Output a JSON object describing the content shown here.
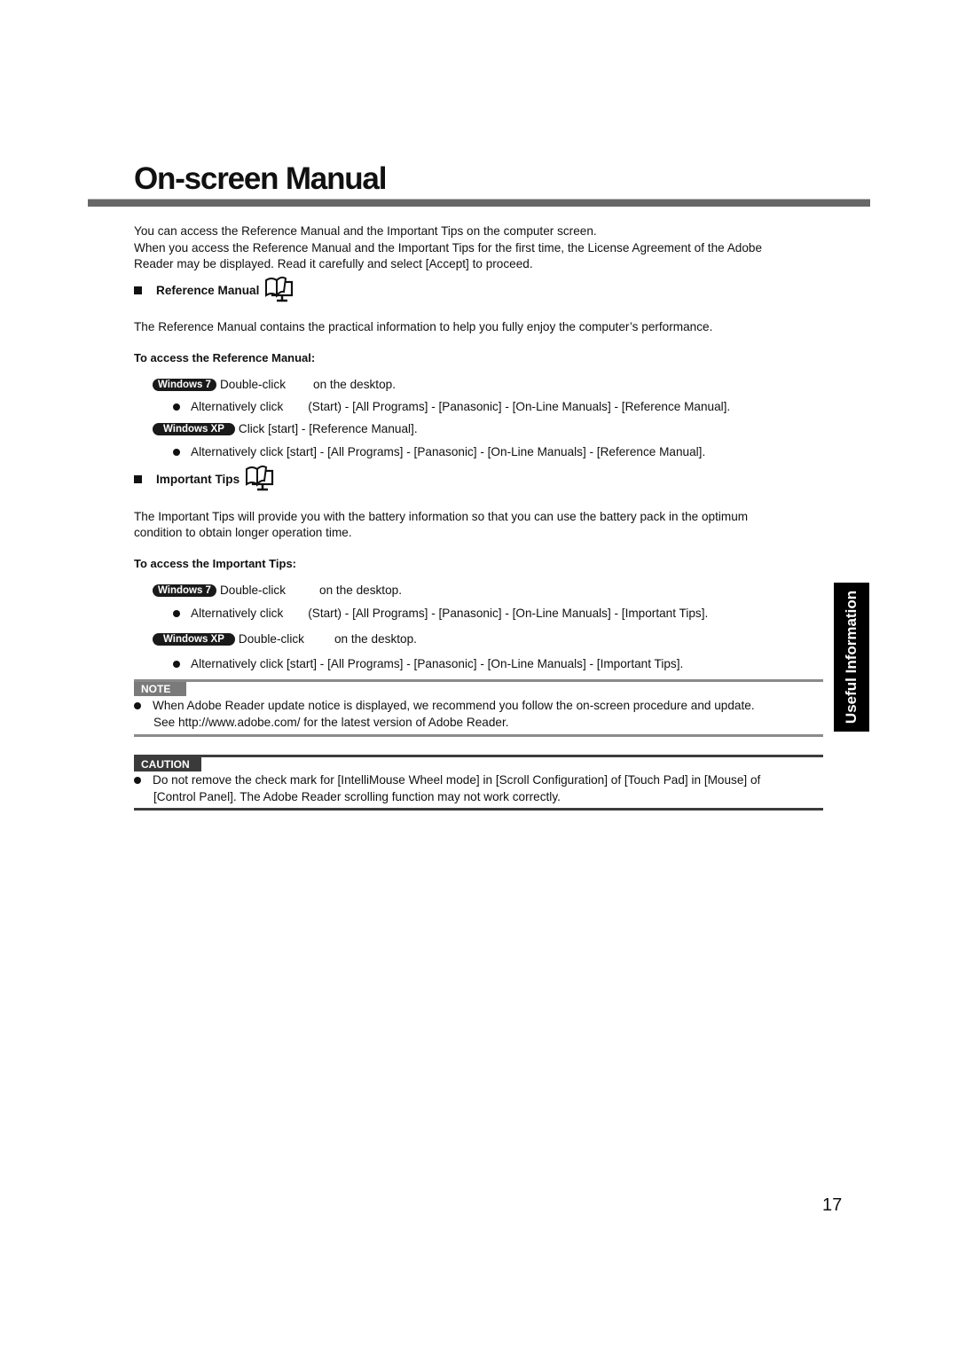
{
  "page": {
    "title": "On-screen Manual",
    "intro": [
      "You can access the Reference Manual and the Important Tips on the computer screen.",
      "When you access the Reference Manual and the Important Tips for the first time, the License Agreement of the Adobe",
      "Reader may be displayed. Read it carefully and select [Accept] to proceed."
    ],
    "side_tab": "Useful Information",
    "page_number": "17"
  },
  "reference_manual": {
    "heading": "Reference Manual",
    "icon": "manual-screen-icon",
    "description": "The Reference Manual contains the practical information to help you fully enjoy the computer’s performance.",
    "access_heading": "To access the Reference Manual:",
    "win7": {
      "badge": "Windows 7",
      "action": "Double-click",
      "action_suffix": "on the desktop.",
      "alt_prefix": "Alternatively click",
      "alt_path": "(Start) - [All Programs] - [Panasonic] - [On-Line Manuals] - [Reference Manual]."
    },
    "winxp": {
      "badge": "Windows XP",
      "action": "Click [start] - [Reference Manual].",
      "alt": "Alternatively click [start] - [All Programs] - [Panasonic] - [On-Line Manuals] - [Reference Manual]."
    }
  },
  "important_tips": {
    "heading": "Important Tips",
    "icon": "manual-screen-icon",
    "description": [
      "The Important Tips will provide you with the battery information so that you can use the battery pack in the optimum",
      "condition to obtain longer operation time."
    ],
    "access_heading": "To access the Important Tips:",
    "win7": {
      "badge": "Windows 7",
      "action": "Double-click",
      "action_suffix": "on the desktop.",
      "alt_prefix": "Alternatively click",
      "alt_path": "(Start) - [All Programs] - [Panasonic] - [On-Line Manuals] - [Important Tips]."
    },
    "winxp": {
      "badge": "Windows XP",
      "action": "Double-click",
      "action_suffix": "on the desktop.",
      "alt": "Alternatively click [start] - [All Programs] - [Panasonic] - [On-Line Manuals] - [Important Tips]."
    }
  },
  "note": {
    "label": "NOTE",
    "lines": [
      "When Adobe Reader update notice is displayed, we recommend you follow the on-screen procedure and update.",
      "See http://www.adobe.com/ for the latest version of Adobe Reader."
    ]
  },
  "caution": {
    "label": "CAUTION",
    "lines": [
      "Do not remove the check mark for [IntelliMouse Wheel mode] in [Scroll Configuration] of [Touch Pad] in [Mouse] of",
      "[Control Panel]. The Adobe Reader scrolling function may not work correctly."
    ]
  }
}
